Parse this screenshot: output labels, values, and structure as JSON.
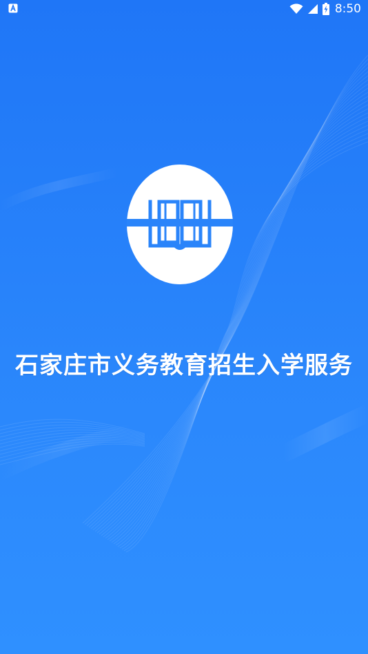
{
  "status_bar": {
    "time": "8:50",
    "left_icon": "a-box-icon",
    "icons": [
      "wifi-icon",
      "cell-signal-icon",
      "battery-charging-icon"
    ]
  },
  "splash": {
    "title": "石家庄市义务教育招生入学服务",
    "logo": "open-book-icon"
  },
  "colors": {
    "background_top": "#1f76f7",
    "background_bottom": "#2f90ff",
    "logo_circle": "#ffffff",
    "logo_book": "#2a84fa",
    "text": "#ffffff"
  }
}
